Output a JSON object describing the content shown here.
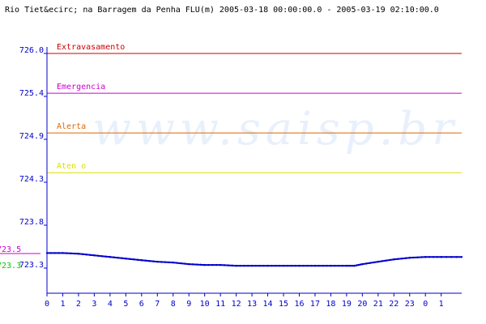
{
  "chart_data": {
    "type": "line",
    "title": "Rio Tiet&ecirc; na Barragem da Penha FLU(m) 2005-03-18 00:00:00.0 - 2005-03-19 02:10:00.0",
    "watermark": "www.saisp.br",
    "xlabel": "",
    "ylabel": "",
    "x_ticks": [
      "0",
      "1",
      "2",
      "3",
      "4",
      "5",
      "6",
      "7",
      "8",
      "9",
      "10",
      "11",
      "12",
      "13",
      "14",
      "15",
      "16",
      "17",
      "18",
      "19",
      "20",
      "21",
      "22",
      "23",
      "0",
      "1"
    ],
    "xlim": [
      0,
      26.3
    ],
    "y_ticks": [
      "726.0",
      "725.4",
      "724.9",
      "724.3",
      "723.8",
      "723.3"
    ],
    "ylim": [
      723.3,
      726.0
    ],
    "thresholds": [
      {
        "label": "Extravasamento",
        "value": 726.0,
        "color": "#cc0000"
      },
      {
        "label": "Emergencia",
        "value": 725.5,
        "color": "#cc00cc"
      },
      {
        "label": "Alerta",
        "value": 725.0,
        "color": "#dd6600"
      },
      {
        "label": "Aten  o",
        "value": 724.5,
        "color": "#dddd00"
      }
    ],
    "markers": [
      {
        "label": "723.5",
        "value": 723.5,
        "color": "#cc00cc"
      },
      {
        "label": "723.3",
        "value": 723.3,
        "color": "#00cc00"
      }
    ],
    "series": [
      {
        "color": "#0000cc",
        "x": [
          0,
          1,
          2,
          3,
          4,
          5,
          6,
          7,
          8,
          9,
          10,
          11,
          12,
          13,
          14,
          15,
          16,
          17,
          18,
          19,
          19.5,
          20,
          21,
          22,
          23,
          24,
          25,
          26.3
        ],
        "y": [
          723.49,
          723.49,
          723.48,
          723.46,
          723.44,
          723.42,
          723.4,
          723.38,
          723.37,
          723.35,
          723.34,
          723.34,
          723.33,
          723.33,
          723.33,
          723.33,
          723.33,
          723.33,
          723.33,
          723.33,
          723.33,
          723.35,
          723.38,
          723.41,
          723.43,
          723.44,
          723.44,
          723.44
        ]
      }
    ],
    "grid": false,
    "colors": {
      "axis": "#0000cc",
      "tick_text": "#0000cc",
      "watermark": "#e8f0fb",
      "series": "#0000cc"
    }
  }
}
